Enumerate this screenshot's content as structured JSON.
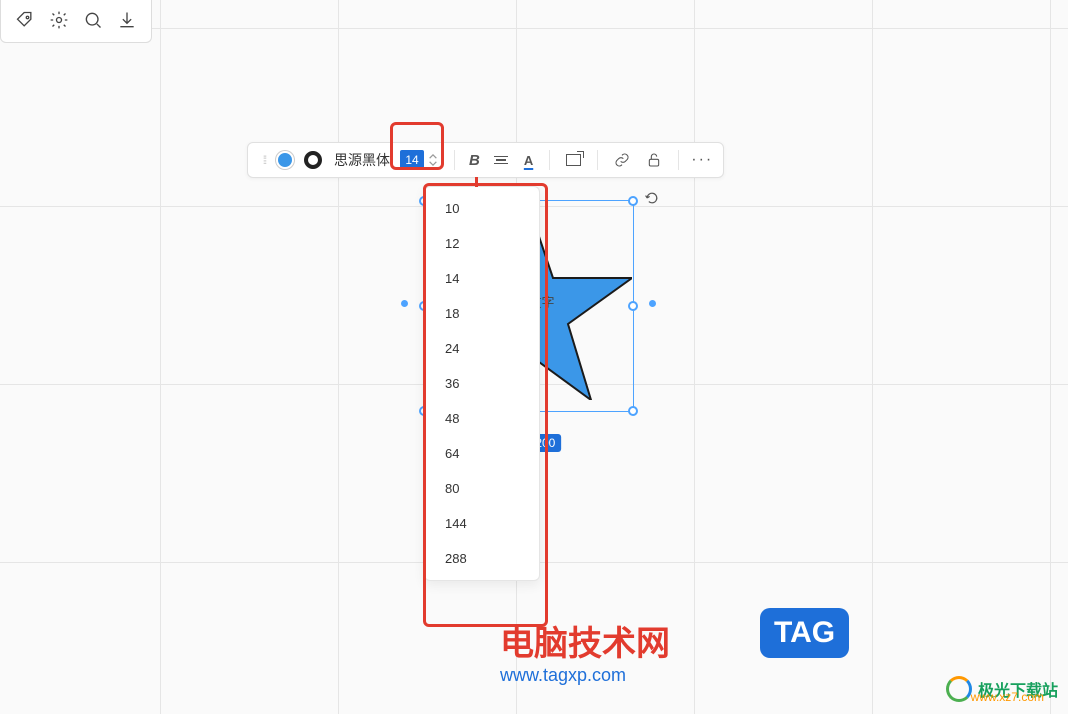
{
  "topToolbar": {
    "icons": [
      "tag-icon",
      "gear-icon",
      "search-icon",
      "download-icon"
    ]
  },
  "contextToolbar": {
    "fillColor": "#3b97e8",
    "strokeColor": "#222222",
    "fontName": "思源黑体",
    "fontSizeInput": "14",
    "boldLabel": "B",
    "textColorLabel": "A",
    "linkHref": "",
    "more": "···"
  },
  "shape": {
    "type": "star",
    "fill": "#3b97e8",
    "stroke": "#1b1b1b",
    "placeholder": "输入文字",
    "dimensions": "207 × 200"
  },
  "fontSizeDropdown": {
    "options": [
      "10",
      "12",
      "14",
      "18",
      "24",
      "36",
      "48",
      "64",
      "80",
      "144",
      "288"
    ]
  },
  "watermarks": {
    "site1": {
      "name": "电脑技术网",
      "url": "www.tagxp.com",
      "tag": "TAG"
    },
    "site2": {
      "name": "极光下载站",
      "url": "www.xz7.com"
    }
  },
  "colors": {
    "accent": "#1e6fd9",
    "annotation": "#e23b2e",
    "shapeFill": "#3b97e8"
  }
}
